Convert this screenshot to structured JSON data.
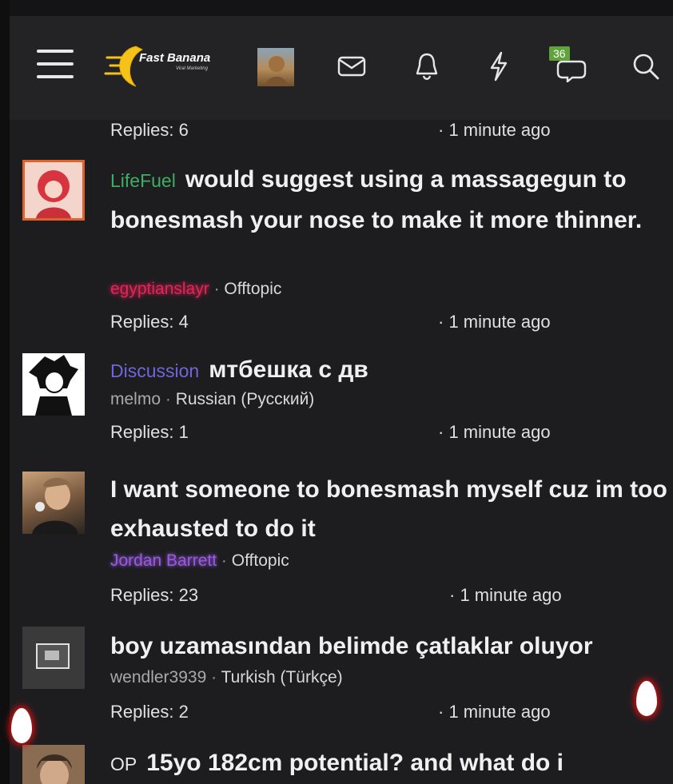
{
  "header": {
    "logo_text": "Fast Banana",
    "logo_sub": "Viral Marketing",
    "conversations_badge": "36",
    "icons": [
      "menu-icon",
      "avatar",
      "mail-icon",
      "bell-icon",
      "lightning-icon",
      "conversations-icon",
      "search-icon"
    ],
    "accent": "#5fa33a"
  },
  "top_partial": {
    "replies": "Replies: 6",
    "time": "· 1 minute ago"
  },
  "threads": [
    {
      "prefix": "LifeFuel",
      "prefix_color": "#3fae62",
      "title": "would suggest using a massagegun to bonesmash your nose to make it more thinner.",
      "author": "egyptianslayr",
      "author_color": "#e0245e",
      "forum": "Offtopic",
      "replies": "Replies: 4",
      "time": "· 1 minute ago"
    },
    {
      "prefix": "Discussion",
      "prefix_color": "#6f67d8",
      "title": "мтбешка с дв",
      "author": "melmo",
      "author_color": "#a9a9a9",
      "forum": "Russian (Русский)",
      "replies": "Replies: 1",
      "time": "· 1 minute ago"
    },
    {
      "prefix": "",
      "title": "I want someone to bonesmash myself cuz im too exhausted to do it",
      "author": "Jordan Barrett",
      "author_color": "#9b59d9",
      "forum": "Offtopic",
      "replies": "Replies: 23",
      "time": "· 1 minute ago"
    },
    {
      "prefix": "",
      "title": "boy uzamasından belimde çatlaklar oluyor",
      "author": "wendler3939",
      "author_color": "#a9a9a9",
      "forum": "Turkish (Türkçe)",
      "replies": "Replies: 2",
      "time": "· 1 minute ago"
    },
    {
      "prefix": "OP",
      "prefix_color": "#e6e6e6",
      "title": "15yo 182cm potential? and what do i"
    }
  ]
}
